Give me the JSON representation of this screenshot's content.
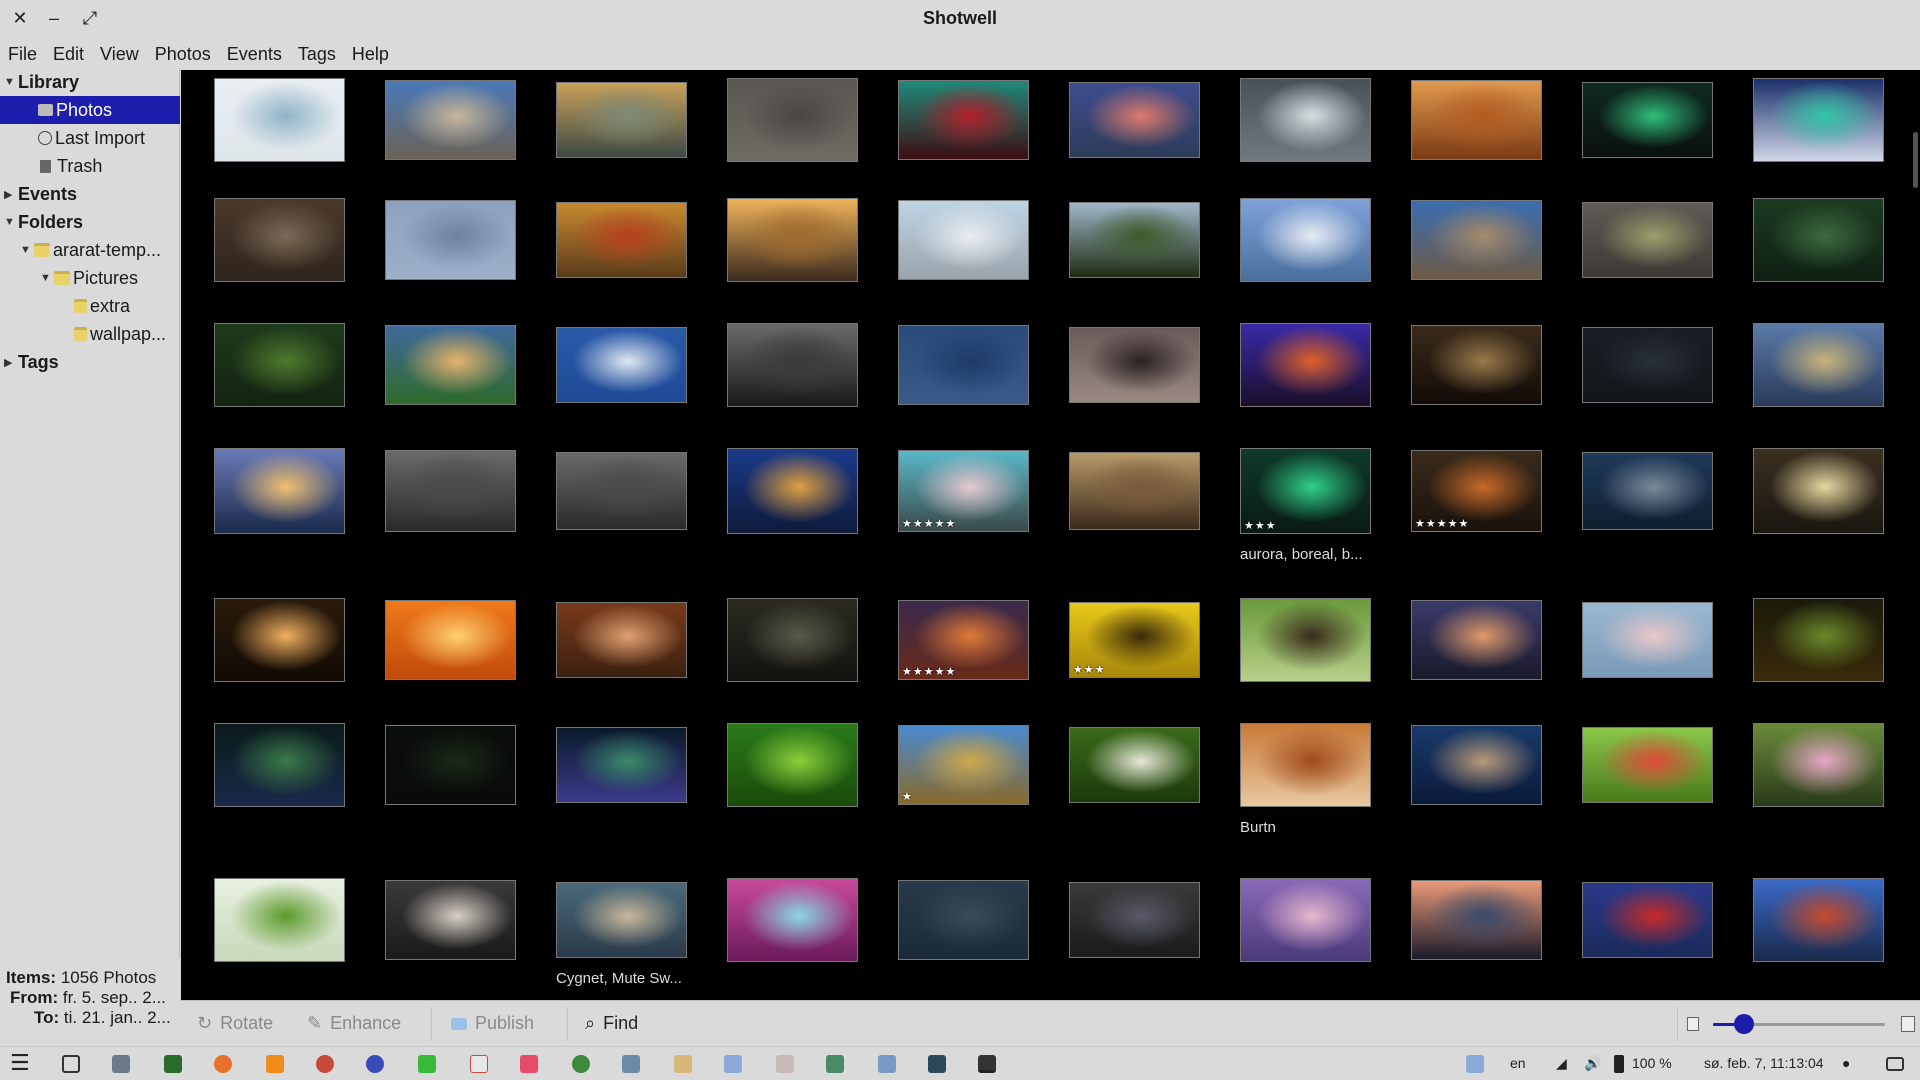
{
  "window": {
    "title": "Shotwell",
    "close_glyph": "✕",
    "minimize_glyph": "–",
    "maximize_glyph": "⤢"
  },
  "menu": [
    "File",
    "Edit",
    "View",
    "Photos",
    "Events",
    "Tags",
    "Help"
  ],
  "sidebar": {
    "library": "Library",
    "photos": "Photos",
    "last_import": "Last Import",
    "trash": "Trash",
    "events": "Events",
    "folders": "Folders",
    "folder_root": "ararat-temp...",
    "folder_pictures": "Pictures",
    "folder_extra": "extra",
    "folder_wallpap": "wallpap...",
    "tags": "Tags"
  },
  "info": {
    "items_label": "Items:",
    "items_value": "1056 Photos",
    "from_label": "From:",
    "from_value": "fr. 5. sep.. 2...",
    "to_label": "To:",
    "to_value": "ti. 21. jan.. 2..."
  },
  "photos": {
    "rows": [
      [
        {
          "colors": [
            "#e9eef2",
            "#8fb4c7",
            "#dfe6ea"
          ]
        },
        {
          "colors": [
            "#4b79b8",
            "#c8b79a",
            "#6b6258"
          ]
        },
        {
          "colors": [
            "#c9a15a",
            "#7d8a78",
            "#3d4a43"
          ]
        },
        {
          "colors": [
            "#5a5651",
            "#4a4642",
            "#6e6a64"
          ]
        },
        {
          "colors": [
            "#1f8a7a",
            "#b21f2b",
            "#3d0d12"
          ]
        },
        {
          "colors": [
            "#3d4d8f",
            "#e07a6a",
            "#2d3b59"
          ]
        },
        {
          "colors": [
            "#4a5156",
            "#d9dfe3",
            "#6f7a80"
          ]
        },
        {
          "colors": [
            "#e19a4e",
            "#b45c20",
            "#7a3a14"
          ]
        },
        {
          "colors": [
            "#0f2a22",
            "#2fbf7a",
            "#0b1010"
          ]
        },
        {
          "colors": [
            "#1b2f6a",
            "#31c5a4",
            "#cfd6e8"
          ]
        }
      ],
      [
        {
          "colors": [
            "#4b3a2c",
            "#7a6a58",
            "#2e241b"
          ]
        },
        {
          "colors": [
            "#8ea2bf",
            "#6e82a0",
            "#9db0c9"
          ]
        },
        {
          "colors": [
            "#c98a2f",
            "#b8401e",
            "#5a3b1a"
          ]
        },
        {
          "colors": [
            "#f0b35a",
            "#a06a2e",
            "#3a2a1e"
          ]
        },
        {
          "colors": [
            "#bfd4e4",
            "#e9eef2",
            "#9aa4ac"
          ]
        },
        {
          "colors": [
            "#9fb7c9",
            "#3f5a2a",
            "#1f2b12"
          ]
        },
        {
          "colors": [
            "#7fa2d8",
            "#e8edf5",
            "#4a6f9e"
          ]
        },
        {
          "colors": [
            "#3a6db0",
            "#a58a6a",
            "#6e5a45"
          ]
        },
        {
          "colors": [
            "#5e5a55",
            "#9aa06a",
            "#3d3a36"
          ]
        },
        {
          "colors": [
            "#1c3a22",
            "#3c6b3f",
            "#0f1f12"
          ]
        }
      ],
      [
        {
          "colors": [
            "#1e3a1c",
            "#4f7a2e",
            "#13230f"
          ]
        },
        {
          "colors": [
            "#3f6a9a",
            "#e6b36a",
            "#2f6a2a"
          ]
        },
        {
          "colors": [
            "#2a5aa8",
            "#dfe8f2",
            "#1e4a96"
          ]
        },
        {
          "colors": [
            "#6a6a6a",
            "#3a3a3a",
            "#1a1a1a"
          ]
        },
        {
          "colors": [
            "#2a4a7a",
            "#1e3a66",
            "#3a5a8a"
          ]
        },
        {
          "colors": [
            "#6a5a5a",
            "#2a2222",
            "#9a8a82"
          ]
        },
        {
          "colors": [
            "#3a2aa8",
            "#e0602a",
            "#1a0f2a"
          ]
        },
        {
          "colors": [
            "#3a2a1a",
            "#9a7a4a",
            "#120c08"
          ]
        },
        {
          "colors": [
            "#1a1e24",
            "#2a3038",
            "#12161a"
          ]
        },
        {
          "colors": [
            "#5a7aa8",
            "#c8b47a",
            "#2a3a5a"
          ]
        }
      ],
      [
        {
          "colors": [
            "#6a7ab8",
            "#f0c070",
            "#1a2a4a"
          ]
        },
        {
          "colors": [
            "#6a6a6a",
            "#4a4a4a",
            "#2a2a2a"
          ]
        },
        {
          "colors": [
            "#6a6a6a",
            "#4a4a4a",
            "#2a2a2a"
          ]
        },
        {
          "colors": [
            "#1a3a8a",
            "#e0a040",
            "#0f1a3a"
          ]
        },
        {
          "colors": [
            "#5ab8c8",
            "#e8c8d0",
            "#3a4a4a"
          ],
          "stars": 5
        },
        {
          "colors": [
            "#b89a6a",
            "#7a5a3a",
            "#3a2a1a"
          ]
        },
        {
          "colors": [
            "#0f3a2a",
            "#2fd08a",
            "#0a1a14"
          ],
          "stars": 3,
          "caption": "aurora, boreal, b..."
        },
        {
          "colors": [
            "#3a2a1a",
            "#c86a2a",
            "#1a120c"
          ],
          "stars": 5
        },
        {
          "colors": [
            "#1e3a5a",
            "#7a8a9a",
            "#0f1e2e"
          ]
        },
        {
          "colors": [
            "#3a3020",
            "#e8d8a0",
            "#1a1610"
          ]
        }
      ],
      [
        {
          "colors": [
            "#2a1a0a",
            "#f0b060",
            "#120a04"
          ]
        },
        {
          "colors": [
            "#f07a1a",
            "#ffd070",
            "#c04a0a"
          ]
        },
        {
          "colors": [
            "#7a3a1a",
            "#e0a070",
            "#3a2010"
          ]
        },
        {
          "colors": [
            "#2a2a22",
            "#5a5a48",
            "#121210"
          ]
        },
        {
          "colors": [
            "#3a2a4a",
            "#e07a3a",
            "#6a2a1a"
          ],
          "stars": 5
        },
        {
          "colors": [
            "#e8c81a",
            "#3a2a0a",
            "#a8880a"
          ],
          "stars": 3
        },
        {
          "colors": [
            "#6a9a3a",
            "#3a2a1a",
            "#b8d08a"
          ]
        },
        {
          "colors": [
            "#3a3a6a",
            "#e09a6a",
            "#1a1a2a"
          ]
        },
        {
          "colors": [
            "#9ab8d0",
            "#e8c8c8",
            "#7a9ab8"
          ]
        },
        {
          "colors": [
            "#1a1a0a",
            "#6a8a2a",
            "#3a2a0a"
          ]
        }
      ],
      [
        {
          "colors": [
            "#0a1a1a",
            "#3a7a4a",
            "#1a2a4a"
          ]
        },
        {
          "colors": [
            "#0a0e0a",
            "#1a2a1a",
            "#0a0a0a"
          ]
        },
        {
          "colors": [
            "#0a1a2a",
            "#3a8a6a",
            "#3a3a8a"
          ]
        },
        {
          "colors": [
            "#2a7a1a",
            "#8ad03a",
            "#1a4a0a"
          ]
        },
        {
          "colors": [
            "#4a8ad0",
            "#d0a84a",
            "#8a6a2a"
          ],
          "stars": 1
        },
        {
          "colors": [
            "#3a6a1a",
            "#e8e8d8",
            "#1a3a0a"
          ]
        },
        {
          "colors": [
            "#c87a3a",
            "#a04a1a",
            "#e8c8a0"
          ],
          "caption": "Burtn"
        },
        {
          "colors": [
            "#1a3a6a",
            "#b89a7a",
            "#0a1a3a"
          ]
        },
        {
          "colors": [
            "#8ac84a",
            "#e04a3a",
            "#4a7a1a"
          ]
        },
        {
          "colors": [
            "#6a8a3a",
            "#e8a8c8",
            "#2a3a1a"
          ]
        }
      ],
      [
        {
          "colors": [
            "#e8f0e0",
            "#5a9a2a",
            "#c8d8b8"
          ]
        },
        {
          "colors": [
            "#3a3a3a",
            "#d8d0c8",
            "#1a1a1a"
          ]
        },
        {
          "colors": [
            "#4a6a7a",
            "#c8b89a",
            "#2a3a4a"
          ],
          "caption": "Cygnet, Mute Sw..."
        },
        {
          "colors": [
            "#c84a9a",
            "#8ad8e8",
            "#6a1a5a"
          ]
        },
        {
          "colors": [
            "#2a3a4a",
            "#3a4a5a",
            "#1a2a3a"
          ]
        },
        {
          "colors": [
            "#3a3a3a",
            "#5a5a6a",
            "#1a1a1a"
          ]
        },
        {
          "colors": [
            "#8a6ab8",
            "#e8b8d0",
            "#4a3a7a"
          ]
        },
        {
          "colors": [
            "#e89a7a",
            "#3a4a6a",
            "#1a1a2a"
          ]
        },
        {
          "colors": [
            "#2a3a8a",
            "#c82a2a",
            "#1a2a5a"
          ]
        },
        {
          "colors": [
            "#3a6ac8",
            "#c84a2a",
            "#1a2a4a"
          ]
        }
      ]
    ]
  },
  "toolbar": {
    "rotate": "Rotate",
    "enhance": "Enhance",
    "publish": "Publish",
    "find": "Find",
    "zoom_level": 0.18
  },
  "taskbar": {
    "language": "en",
    "volume_percent": "100 %",
    "clock": "sø. feb. 7, 11:13:04"
  }
}
